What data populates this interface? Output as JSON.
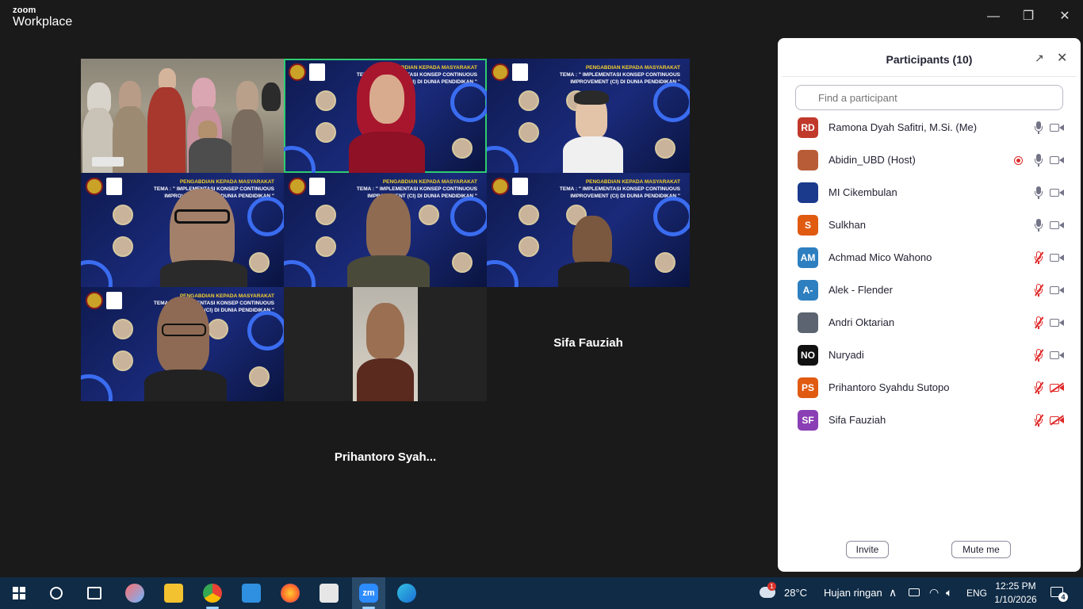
{
  "window": {
    "logo_line1": "zoom",
    "logo_line2": "Workplace",
    "minimize": "—",
    "restore": "❐",
    "close": "✕"
  },
  "slide": {
    "line1": "PENGABDIAN KEPADA MASYARAKAT",
    "line2": "TEMA : \" IMPLEMENTASI KONSEP CONTINUOUS",
    "line3": "IMPROVEMENT (CI) DI DUNIA PENDIDIKAN \""
  },
  "video": {
    "audio_only_1": "Sifa Fauziah",
    "audio_only_2": "Prihantoro  Syah..."
  },
  "panel": {
    "title": "Participants (10)",
    "search_placeholder": "Find a participant",
    "invite": "Invite",
    "mute_me": "Mute me",
    "participants": [
      {
        "initials": "RD",
        "name": "Ramona Dyah Safitri, M.Si. (Me)",
        "color": "#c0392b",
        "mic": "on",
        "cam": "on"
      },
      {
        "initials": "",
        "name": "Abidin_UBD (Host)",
        "color": "#b85c38",
        "mic": "on",
        "cam": "on",
        "recording": true
      },
      {
        "initials": "",
        "name": "MI Cikembulan",
        "color": "#1b3a8c",
        "mic": "on",
        "cam": "on"
      },
      {
        "initials": "S",
        "name": "Sulkhan",
        "color": "#e05a10",
        "mic": "on",
        "cam": "on"
      },
      {
        "initials": "AM",
        "name": "Achmad Mico Wahono",
        "color": "#2e7fbf",
        "mic": "muted",
        "cam": "on"
      },
      {
        "initials": "A-",
        "name": "Alek - Flender",
        "color": "#2e7fbf",
        "mic": "muted",
        "cam": "on"
      },
      {
        "initials": "",
        "name": "Andri Oktarian",
        "color": "#5b6470",
        "mic": "muted",
        "cam": "on"
      },
      {
        "initials": "NO",
        "name": "Nuryadi",
        "color": "#111111",
        "mic": "muted",
        "cam": "on"
      },
      {
        "initials": "PS",
        "name": "Prihantoro Syahdu Sutopo",
        "color": "#e05a10",
        "mic": "muted",
        "cam": "off"
      },
      {
        "initials": "SF",
        "name": "Sifa Fauziah",
        "color": "#8a3fb5",
        "mic": "muted",
        "cam": "off"
      }
    ]
  },
  "taskbar": {
    "weather_temp": "28°C",
    "weather_desc": "Hujan ringan",
    "weather_badge": "1",
    "lang": "ENG",
    "time": "12:25 PM",
    "date": "1/10/2026",
    "notif_count": "4",
    "zoom_label": "zm"
  }
}
